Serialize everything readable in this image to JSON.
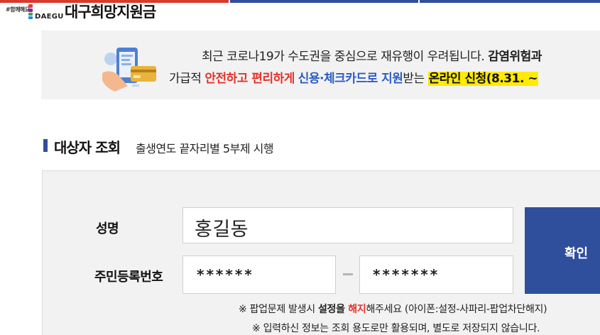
{
  "header": {
    "logo_tag": "#함께해요",
    "logo_city": "DAEGU",
    "title": "대구희망지원금"
  },
  "notice": {
    "icon": "card-payment-phone-icon",
    "line1_a": "최근 코로나19가 수도권을 중심으로 재유행이 우려됩니다. ",
    "line1_b": "감염위험과",
    "line2_a": "가급적 ",
    "line2_red": "안전하고 편리하게",
    "line2_space": " ",
    "line2_blue": "신용·체크카드로 지원",
    "line2_c": "받는 ",
    "line2_hl": "온라인 신청(8.31. ~"
  },
  "section": {
    "title": "대상자 조회",
    "subtitle": "출생연도 끝자리별 5부제 시행"
  },
  "form": {
    "name_label": "성명",
    "name_value": "홍길동",
    "rrn_label": "주민등록번호",
    "rrn_front": "******",
    "rrn_back": "*******",
    "confirm_label": "확인"
  },
  "notes": {
    "popup_a": "※ 팝업문제 발생시 ",
    "popup_b": "설정을 ",
    "popup_c": "해지",
    "popup_d": "해주세요 (아이폰:설정-사파리-팝업차단해지)",
    "privacy": "※ 입력하신 정보는 조회 용도로만 활용되며, 별도로 저장되지 않습니다."
  },
  "colors": {
    "brand_blue": "#2f4e9c",
    "accent_red": "#e3322b",
    "accent_blue": "#2c5cc5",
    "highlight_yellow": "#ffea00"
  }
}
